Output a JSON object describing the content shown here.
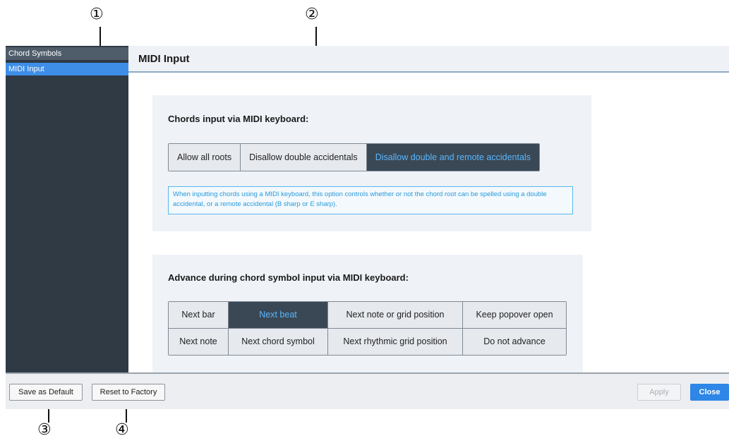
{
  "callouts": [
    "①",
    "②",
    "③",
    "④"
  ],
  "sidebar": {
    "items": [
      {
        "label": "Chord Symbols"
      },
      {
        "label": "MIDI Input"
      }
    ]
  },
  "content": {
    "title": "MIDI Input",
    "section1": {
      "title": "Chords input via MIDI keyboard:",
      "options": [
        {
          "label": "Allow all roots",
          "selected": false
        },
        {
          "label": "Disallow double accidentals",
          "selected": false
        },
        {
          "label": "Disallow double and remote accidentals",
          "selected": true
        }
      ],
      "info": "When inputting chords using a MIDI keyboard, this option controls whether or not the chord root can be spelled using a double accidental, or a remote accidental (B sharp or E sharp)."
    },
    "section2": {
      "title": "Advance during chord symbol input via MIDI keyboard:",
      "options": [
        {
          "label": "Next bar",
          "selected": false
        },
        {
          "label": "Next beat",
          "selected": true
        },
        {
          "label": "Next note or grid position",
          "selected": false
        },
        {
          "label": "Keep popover open",
          "selected": false
        },
        {
          "label": "Next note",
          "selected": false
        },
        {
          "label": "Next chord symbol",
          "selected": false
        },
        {
          "label": "Next rhythmic grid position",
          "selected": false
        },
        {
          "label": "Do not advance",
          "selected": false
        }
      ]
    }
  },
  "footer": {
    "save_default": "Save as Default",
    "reset_factory": "Reset to Factory",
    "apply": "Apply",
    "close": "Close"
  },
  "colors": {
    "sidebar_bg": "#2f3a45",
    "selected_item": "#3e8ee8",
    "selected_segment_bg": "#3a4855",
    "selected_segment_text": "#59b6ff",
    "info_border": "#58b7ec",
    "close_button": "#2e86e6"
  }
}
